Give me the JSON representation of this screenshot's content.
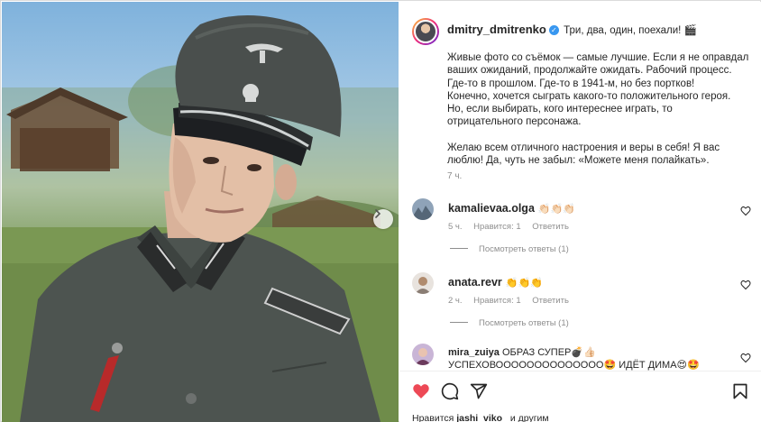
{
  "post": {
    "username": "dmitry_dmitrenko",
    "lead": "Три, два, один, поехали! 🎬",
    "body": "Живые фото со съёмок — самые лучшие. Если я не оправдал ваших ожиданий, продолжайте ожидать. Рабочий процесс. Где-то в прошлом. Где-то в 1941-м, но без портков!\nКонечно, хочется сыграть какого-то положительного героя. Но, если выбирать, кого интереснее играть, то отрицательного персонажа.\n\nЖелаю всем отличного настроения и веры в себя! Я вас люблю! Да, чуть не забыл: «Можете меня полайкать».",
    "time": "7 ч."
  },
  "comments": [
    {
      "username": "kamalievaa.olga",
      "text": "👏🏻👏🏻👏🏻",
      "time": "5 ч.",
      "likes": "Нравится: 1",
      "reply": "Ответить",
      "view_replies": "Посмотреть ответы (1)"
    },
    {
      "username": "anata.revr",
      "text": "👏👏👏",
      "time": "2 ч.",
      "likes": "Нравится: 1",
      "reply": "Ответить",
      "view_replies": "Посмотреть ответы (1)"
    },
    {
      "username": "mira_zuiya",
      "text": "ОБРАЗ СУПЕР💣👍🏻 УСПЕХОВОООООООООООООО🤩 ИДЁТ ДИМА😍🤩"
    }
  ],
  "footer": {
    "likes_prefix": "Нравится",
    "likes_user": "jashi_viko_",
    "likes_suffix": "и другим"
  },
  "icons": {
    "like": "heart-filled-icon",
    "comment": "comment-icon",
    "share": "share-icon",
    "save": "bookmark-icon",
    "next": "chevron-right-icon"
  },
  "colors": {
    "like_red": "#ed4956",
    "verified_blue": "#3897f0",
    "muted": "#8e8e8e"
  }
}
